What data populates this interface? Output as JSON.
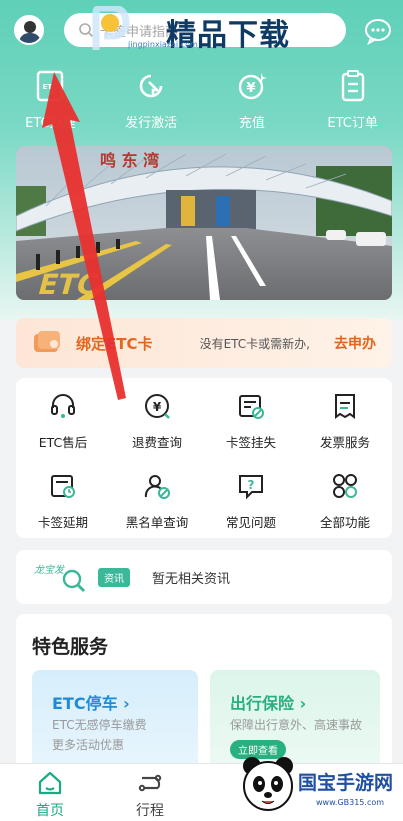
{
  "search": {
    "placeholder": "卡签申请指南"
  },
  "watermark_top": {
    "title": "精品下载",
    "url": "jingpinxiazai.com"
  },
  "quick_actions": [
    {
      "label": "ETC办理",
      "icon": "etc-card-icon"
    },
    {
      "label": "发行激活",
      "icon": "activate-icon"
    },
    {
      "label": "充值",
      "icon": "recharge-icon"
    },
    {
      "label": "ETC订单",
      "icon": "order-icon"
    }
  ],
  "banner": {
    "sign_text": "鸣 东 湾",
    "road_text": "ETC"
  },
  "bind_card": {
    "title": "绑定ETC卡",
    "desc": "没有ETC卡或需新办,",
    "action": "去申办"
  },
  "services": [
    {
      "label": "ETC售后",
      "icon": "headset-icon"
    },
    {
      "label": "退费查询",
      "icon": "refund-icon"
    },
    {
      "label": "卡签挂失",
      "icon": "report-loss-icon"
    },
    {
      "label": "发票服务",
      "icon": "invoice-icon"
    },
    {
      "label": "卡签延期",
      "icon": "extend-icon"
    },
    {
      "label": "黑名单查询",
      "icon": "blacklist-icon"
    },
    {
      "label": "常见问题",
      "icon": "faq-icon"
    },
    {
      "label": "全部功能",
      "icon": "all-functions-icon"
    }
  ],
  "news": {
    "logo_text": "龙宝发",
    "tag": "资讯",
    "text": "暂无相关资讯"
  },
  "feature": {
    "title": "特色服务",
    "cards": [
      {
        "title": "ETC停车 ›",
        "lines": [
          "ETC无感停车缴费",
          "更多活动优惠"
        ],
        "button": ""
      },
      {
        "title": "出行保险 ›",
        "lines": [
          "保障出行意外、高速事故"
        ],
        "button": "立即查看"
      }
    ]
  },
  "tabbar": [
    {
      "label": "首页",
      "icon": "home-icon",
      "active": true
    },
    {
      "label": "行程",
      "icon": "trip-icon",
      "active": false
    }
  ],
  "watermark_bottom": {
    "title": "国宝手游网",
    "url": "www.GB315.com"
  },
  "colors": {
    "brand": "#5fd0b8",
    "accent": "#e2661e",
    "active_tab": "#1aa985"
  }
}
